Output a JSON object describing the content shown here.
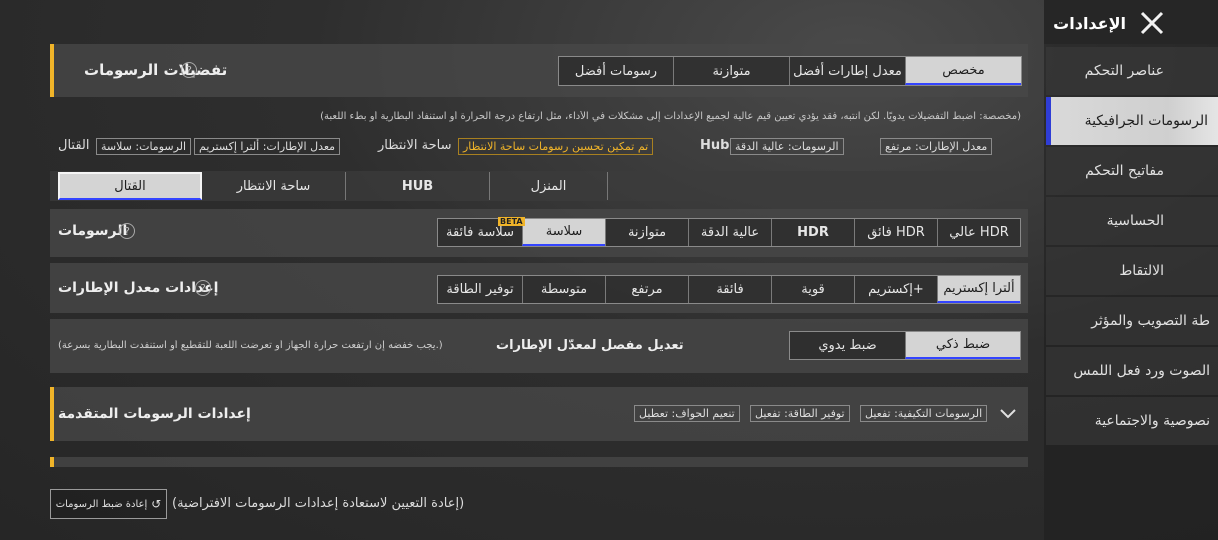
{
  "header": {
    "title": "الإعدادات",
    "close_icon": "close-icon"
  },
  "sidebar": {
    "items": [
      {
        "label": "عناصر التحكم"
      },
      {
        "label": "الرسومات الجرافيكية"
      },
      {
        "label": "مفاتيح التحكم"
      },
      {
        "label": "الحساسية"
      },
      {
        "label": "الالتقاط"
      },
      {
        "label": "طة التصويب والمؤثر"
      },
      {
        "label": "الصوت ورد فعل اللمس"
      },
      {
        "label": "نصوصية والاجتماعية"
      }
    ],
    "active_index": 1
  },
  "prefs": {
    "title": "تفضيلات الرسومات",
    "options": [
      "مخصص",
      "معدل إطارات أفضل",
      "متوازنة",
      "رسومات أفضل"
    ],
    "selected": "مخصص",
    "note": "(مخصصة: اضبط التفضيلات يدويًا. لكن انتبه، فقد يؤدي تعيين قيم عالية لجميع الإعدادات إلى مشكلات في الأداء، مثل ارتفاع درجة الحرارة أو استنفاد البطارية أو بطء اللعبة)",
    "summary": {
      "hub_label": "Hub",
      "hub_fps": "معدل الإطارات: مرتفع",
      "hub_gfx": "الرسومات: عالية الدقة",
      "lobby_label": "ساحة الانتظار",
      "lobby_note": "تم تمكين تحسين رسومات ساحة الانتظار",
      "combat_label": "القتال",
      "combat_fps": "معدل الإطارات: ألترا إكستريم",
      "combat_gfx": "الرسومات: سلاسة"
    }
  },
  "scene_tabs": [
    "المنزل",
    "HUB",
    "ساحة الانتظار",
    "القتال"
  ],
  "scene_selected": "القتال",
  "graphics": {
    "title": "الرسومات",
    "options": [
      "عالي HDR",
      "فائق HDR",
      "HDR",
      "عالية الدقة",
      "متوازنة",
      "سلاسة",
      "سلاسة فائقة"
    ],
    "selected": "سلاسة",
    "beta_badge": "BETA"
  },
  "fps": {
    "title": "إعدادات معدل الإطارات",
    "options": [
      "ألترا إكستريم",
      "إكستريم+",
      "قوية",
      "فائقة",
      "مرتفع",
      "متوسطة",
      "توفير الطاقة"
    ],
    "selected": "ألترا إكستريم"
  },
  "adjust": {
    "title": "تعديل مفصل لمعدّل الإطارات",
    "note": "(يجب خفضه إن ارتفعت حرارة الجهاز أو تعرضت اللعبة للتقطيع أو استنفدت البطارية بسرعة.)",
    "options": [
      "ضبط ذكي",
      "ضبط يدوي"
    ],
    "selected": "ضبط ذكي"
  },
  "advanced": {
    "title": "إعدادات الرسومات المتقدمة",
    "tags": [
      "الرسومات التكيفية: تفعيل",
      "توفير الطاقة: تفعيل",
      "تنعيم الحواف: تعطيل"
    ]
  },
  "reset": {
    "button_label": "إعادة ضبط الرسومات",
    "description": "(إعادة التعيين لاستعادة إعدادات الرسومات الافتراضية)"
  },
  "colors": {
    "accent": "#f0b429",
    "selected_bg": "#d4d4d4",
    "selected_underline": "#3344ff",
    "active_sidebar_border": "#2f3dd6"
  }
}
